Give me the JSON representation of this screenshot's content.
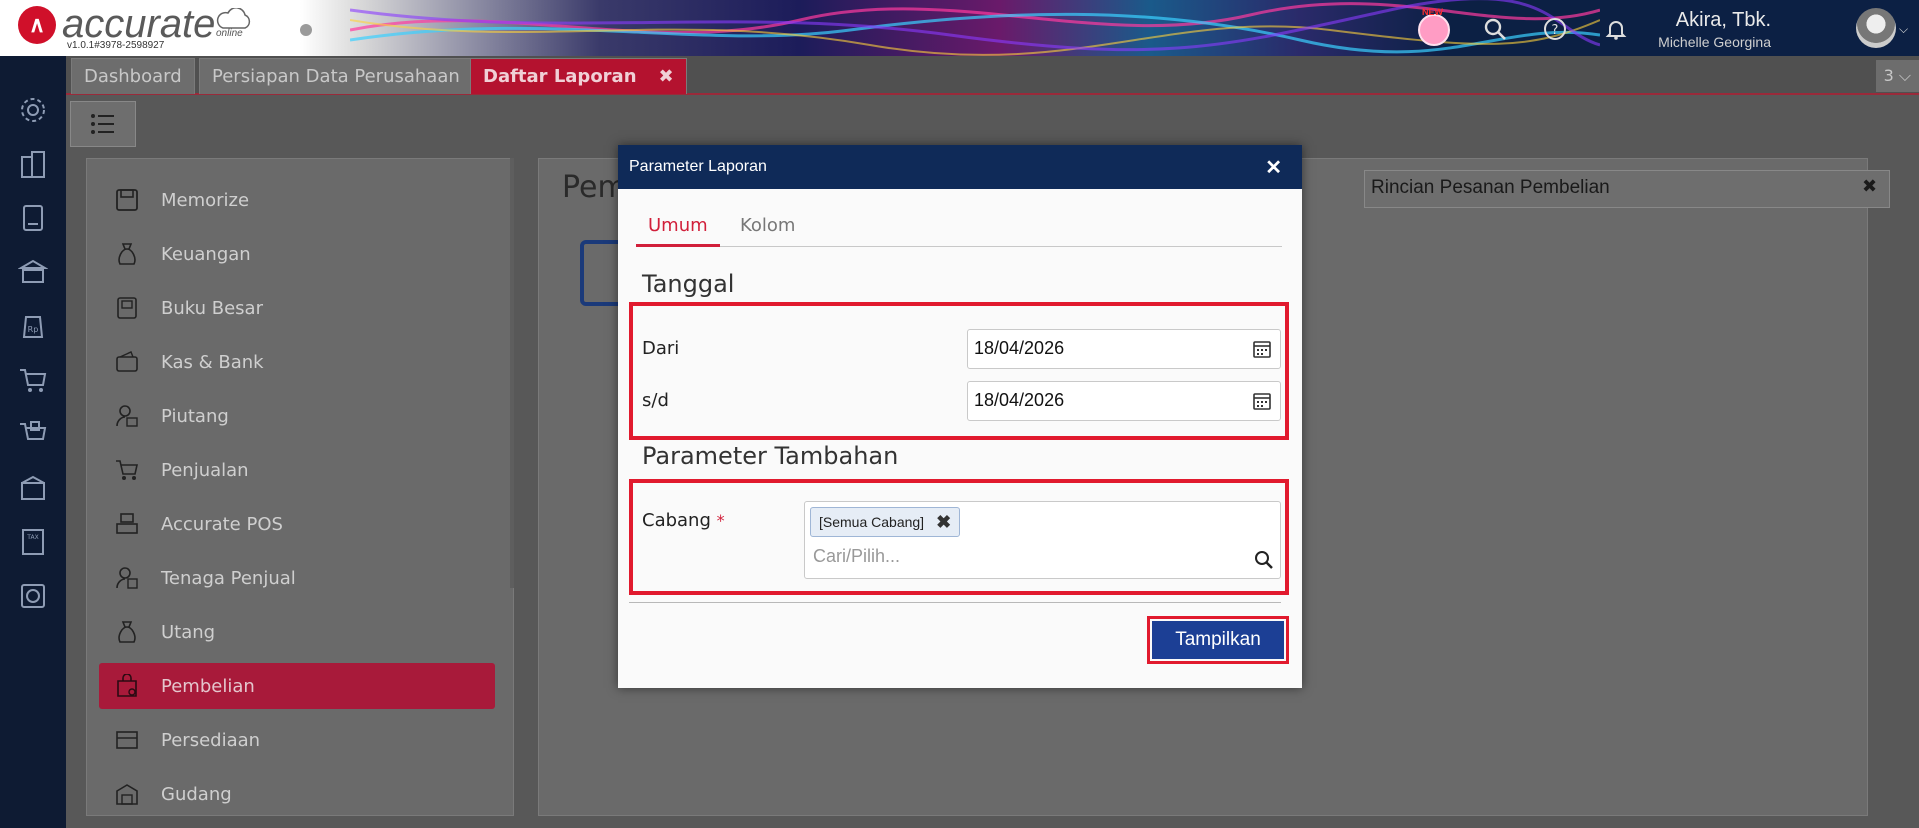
{
  "app": {
    "brand": "accurate",
    "brand_sub": "online",
    "version": "v1.0.1#3978-2598927",
    "user_company": "Akira, Tbk.",
    "user_name": "Michelle Georgina",
    "new_badge": "NEW"
  },
  "tabs": [
    {
      "label": "Dashboard"
    },
    {
      "label": "Persiapan Data Perusahaan"
    },
    {
      "label": "Daftar Laporan",
      "close": "✖"
    }
  ],
  "tab_count": "3 ⌵",
  "menu": {
    "items": [
      {
        "label": "Memorize",
        "icon": "save-icon"
      },
      {
        "label": "Keuangan",
        "icon": "money-bag-icon"
      },
      {
        "label": "Buku Besar",
        "icon": "ledger-icon"
      },
      {
        "label": "Kas & Bank",
        "icon": "wallet-icon"
      },
      {
        "label": "Piutang",
        "icon": "receivable-icon"
      },
      {
        "label": "Penjualan",
        "icon": "cart-icon"
      },
      {
        "label": "Accurate POS",
        "icon": "pos-icon"
      },
      {
        "label": "Tenaga Penjual",
        "icon": "salesperson-icon"
      },
      {
        "label": "Utang",
        "icon": "payable-icon"
      },
      {
        "label": "Pembelian",
        "icon": "purchase-bag-icon"
      },
      {
        "label": "Persediaan",
        "icon": "inventory-icon"
      },
      {
        "label": "Gudang",
        "icon": "warehouse-icon"
      }
    ],
    "active_index": 9
  },
  "right_panel": {
    "title": "Pem",
    "report_search": "Rincian Pesanan Pembelian",
    "clear": "✖"
  },
  "modal": {
    "title": "Parameter Laporan",
    "close": "✕",
    "tabs": [
      {
        "label": "Umum"
      },
      {
        "label": "Kolom"
      }
    ],
    "section_date": "Tanggal",
    "from_label": "Dari",
    "from_value": "18/04/2026",
    "to_label": "s/d",
    "to_value": "18/04/2026",
    "section_extra": "Parameter Tambahan",
    "branch_label": "Cabang",
    "required_mark": "*",
    "branch_chip": "[Semua Cabang]",
    "chip_remove": "✖",
    "branch_placeholder": "Cari/Pilih...",
    "submit": "Tampilkan"
  },
  "colors": {
    "accent_red": "#d11f3a",
    "header_navy": "#0f2a58",
    "button_blue": "#1c3f95",
    "highlight_box": "#e11a2e"
  }
}
